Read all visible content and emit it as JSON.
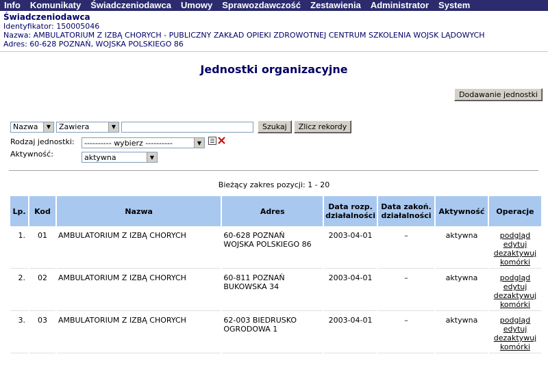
{
  "menu": [
    "Info",
    "Komunikaty",
    "Świadczeniodawca",
    "Umowy",
    "Sprawozdawczość",
    "Zestawienia",
    "Administrator",
    "System"
  ],
  "provider": {
    "title": "Świadczeniodawca",
    "identifier": "Identyfikator: 150005046",
    "name": "Nazwa: AMBULATORIUM Z IZBĄ CHORYCH - PUBLICZNY ZAKŁAD OPIEKI ZDROWOTNEJ CENTRUM SZKOLENIA WOJSK LĄDOWYCH",
    "address": "Adres: 60-628 POZNAŃ, WOJSKA POLSKIEGO 86"
  },
  "page_title": "Jednostki organizacyjne",
  "add_button": "Dodawanie jednostki",
  "filter": {
    "field": "Nazwa",
    "operator": "Zawiera",
    "search_value": "",
    "search_button": "Szukaj",
    "count_button": "Zlicz rekordy",
    "unit_type_label": "Rodzaj jednostki:",
    "unit_type_value": "---------- wybierz ----------",
    "activity_label": "Aktywność:",
    "activity_value": "aktywna"
  },
  "range": "Bieżący zakres pozycji: 1 - 20",
  "table": {
    "headers": [
      "Lp.",
      "Kod",
      "Nazwa",
      "Adres",
      "Data rozp. działalności",
      "Data zakoń. działalności",
      "Aktywność",
      "Operacje"
    ],
    "ops": [
      "podgląd",
      "edytuj",
      "dezaktywuj",
      "komórki"
    ],
    "rows": [
      {
        "lp": "1.",
        "kod": "01",
        "nazwa": "AMBULATORIUM Z IZBĄ CHORYCH",
        "adres1": "60-628 POZNAŃ",
        "adres2": "WOJSKA POLSKIEGO 86",
        "start": "2003-04-01",
        "end": "–",
        "aktywnosc": "aktywna"
      },
      {
        "lp": "2.",
        "kod": "02",
        "nazwa": "AMBULATORIUM Z IZBĄ CHORYCH",
        "adres1": "60-811 POZNAŃ",
        "adres2": "BUKOWSKA 34",
        "start": "2003-04-01",
        "end": "–",
        "aktywnosc": "aktywna"
      },
      {
        "lp": "3.",
        "kod": "03",
        "nazwa": "AMBULATORIUM Z IZBĄ CHORYCH",
        "adres1": "62-003 BIEDRUSKO",
        "adres2": "OGRODOWA 1",
        "start": "2003-04-01",
        "end": "–",
        "aktywnosc": "aktywna"
      }
    ]
  }
}
